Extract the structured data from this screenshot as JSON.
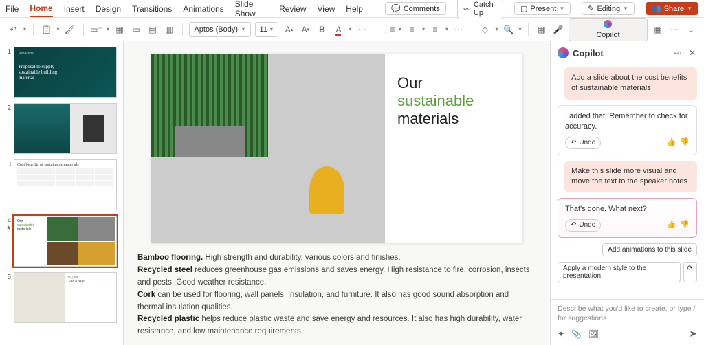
{
  "menu": {
    "tabs": [
      "File",
      "Home",
      "Insert",
      "Design",
      "Transitions",
      "Animations",
      "Slide Show",
      "Review",
      "View",
      "Help"
    ],
    "active_index": 1,
    "right": {
      "comments": "Comments",
      "catch_up": "Catch Up",
      "present": "Present",
      "editing": "Editing",
      "share": "Share"
    }
  },
  "ribbon": {
    "font_name": "Aptos (Body)",
    "font_size": "11",
    "copilot_label": "Copilot"
  },
  "thumbs": [
    {
      "num": "1",
      "title": "Proposal to supply sustainable building material",
      "brand": "VanArsdel"
    },
    {
      "num": "2",
      "text": ""
    },
    {
      "num": "3",
      "title": "Cost benefits of sustainable materials"
    },
    {
      "num": "4",
      "title_l1": "Our",
      "title_l2": "sustainable",
      "title_l3": "materials",
      "selected": true
    },
    {
      "num": "5",
      "prefix": "HQ for",
      "brand": "VanArsdel"
    }
  ],
  "slide": {
    "title_l1": "Our",
    "title_l2": "sustainable",
    "title_l3": "materials"
  },
  "notes": {
    "p1_b": "Bamboo flooring.",
    "p1": " High strength and durability, various colors and finishes.",
    "p2_b": "Recycled steel",
    "p2": " reduces greenhouse gas emissions and saves energy. High resistance to fire, corrosion, insects and pests. Good weather resistance.",
    "p3_b": "Cork",
    "p3": " can be used for flooring, wall panels, insulation, and furniture. It also has good sound absorption and thermal insulation qualities.",
    "p4_b": "Recycled plastic",
    "p4": " helps reduce plastic waste and save energy and resources. It also has high durability, water resistance, and low maintenance requirements."
  },
  "copilot": {
    "title": "Copilot",
    "messages": [
      {
        "role": "user",
        "text": "Add a slide about the cost benefits of sustainable materials"
      },
      {
        "role": "bot",
        "text": "I added that. Remember to check for accuracy.",
        "undo": "Undo"
      },
      {
        "role": "user",
        "text": "Make this slide more visual and move the text to the speaker notes"
      },
      {
        "role": "bot",
        "text": "That's done. What next?",
        "undo": "Undo",
        "accent": true
      }
    ],
    "suggestions": [
      "Add animations to this slide",
      "Apply a modern style to the presentation"
    ],
    "placeholder": "Describe what you'd like to create, or type / for suggestions"
  }
}
